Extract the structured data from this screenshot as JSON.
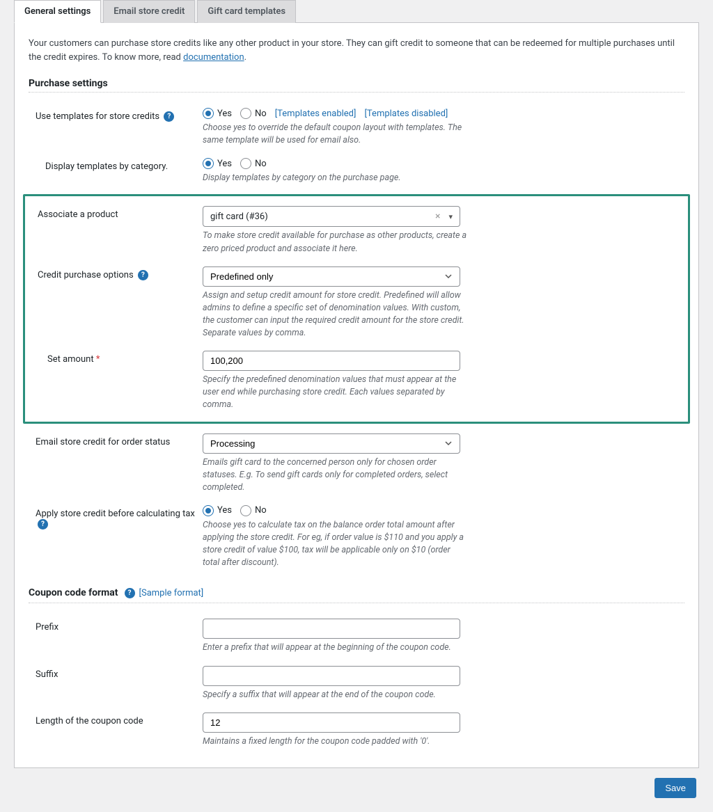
{
  "tabs": {
    "general": "General settings",
    "email": "Email store credit",
    "templates": "Gift card templates"
  },
  "intro": {
    "text_a": "Your customers can purchase store credits like any other product in your store. They can gift credit to someone that can be redeemed for multiple purchases until the credit expires. To know more, read ",
    "doc_link": "documentation",
    "text_b": "."
  },
  "sections": {
    "purchase_title": "Purchase settings",
    "coupon_title": "Coupon code format"
  },
  "options": {
    "yes": "Yes",
    "no": "No",
    "templates_enabled": "[Templates enabled]",
    "templates_disabled": "[Templates disabled]",
    "sample_format": "[Sample format]",
    "help_glyph": "?"
  },
  "fields": {
    "use_templates": {
      "label": "Use templates for store credits",
      "desc": "Choose yes to override the default coupon layout with templates. The same template will be used for email also."
    },
    "display_by_category": {
      "label": "Display templates by category.",
      "desc": "Display templates by category on the purchase page."
    },
    "associate_product": {
      "label": "Associate a product",
      "value": "gift card (#36)",
      "desc": "To make store credit available for purchase as other products, create a zero priced product and associate it here."
    },
    "credit_options": {
      "label": "Credit purchase options",
      "value": "Predefined only",
      "desc": "Assign and setup credit amount for store credit. Predefined will allow admins to define a specific set of denomination values. With custom, the customer can input the required credit amount for the store credit. Separate values by comma."
    },
    "set_amount": {
      "label": "Set amount",
      "value": "100,200",
      "desc": "Specify the predefined denomination values that must appear at the user end while purchasing store credit. Each values separated by comma."
    },
    "email_status": {
      "label": "Email store credit for order status",
      "value": "Processing",
      "desc": "Emails gift card to the concerned person only for chosen order statuses. E.g. To send gift cards only for completed orders, select completed."
    },
    "apply_before_tax": {
      "label": "Apply store credit before calculating tax",
      "desc": "Choose yes to calculate tax on the balance order total amount after applying the store credit. For eg, if order value is $110 and you apply a store credit of value $100, tax will be applicable only on $10 (order total after discount)."
    },
    "prefix": {
      "label": "Prefix",
      "value": "",
      "desc": "Enter a prefix that will appear at the beginning of the coupon code."
    },
    "suffix": {
      "label": "Suffix",
      "value": "",
      "desc": "Specify a suffix that will appear at the end of the coupon code."
    },
    "length": {
      "label": "Length of the coupon code",
      "value": "12",
      "desc": "Maintains a fixed length for the coupon code padded with '0'."
    }
  },
  "buttons": {
    "save": "Save"
  }
}
